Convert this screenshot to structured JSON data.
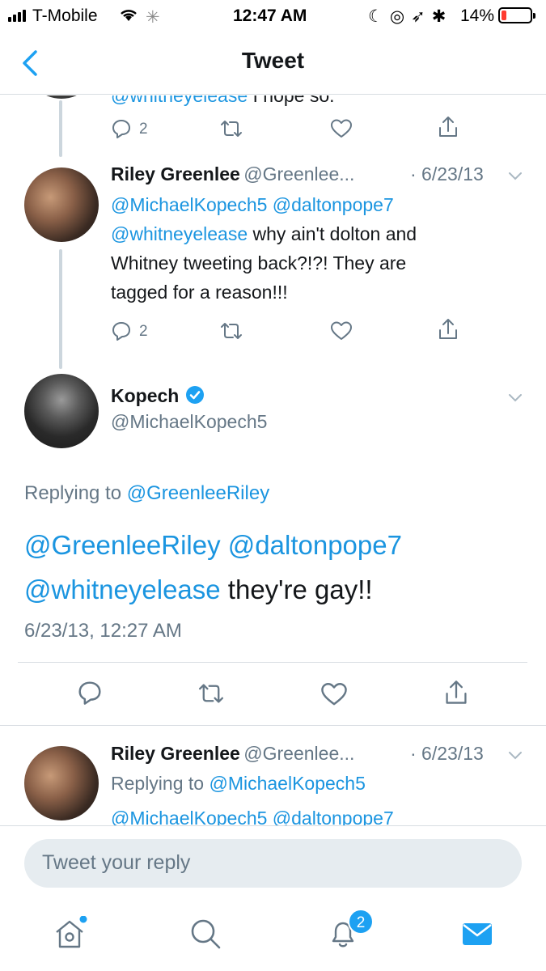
{
  "status_bar": {
    "carrier": "T-Mobile",
    "time": "12:47 AM",
    "battery": "14%"
  },
  "nav": {
    "title": "Tweet"
  },
  "top_tweet": {
    "partial_text_link": "@whitneyelease",
    "partial_text": " I hope so.",
    "reply_count": "2"
  },
  "reply_1": {
    "name": "Riley Greenlee",
    "handle": "@Greenlee...",
    "date": "· 6/23/13",
    "mentions": [
      "@MichaelKopech5",
      "@daltonpope7",
      "@whitneyelease"
    ],
    "text_line1": " why ain't dolton and",
    "text_line2": "Whitney tweeting back?!?! They are",
    "text_line3": "tagged for a reason!!!",
    "reply_count": "2"
  },
  "main_tweet": {
    "name": "Kopech",
    "handle": "@MichaelKopech5",
    "replying_prefix": "Replying to ",
    "replying_to": "@GreenleeRiley",
    "mentions": [
      "@GreenleeRiley",
      "@daltonpope7",
      "@whitneyelease"
    ],
    "text": " they're gay!!",
    "timestamp": "6/23/13, 12:27 AM"
  },
  "reply_2": {
    "name": "Riley Greenlee",
    "handle": "@Greenlee...",
    "date": "· 6/23/13",
    "replying_prefix": "Replying to ",
    "replying_to": "@MichaelKopech5",
    "mentions": [
      "@MichaelKopech5",
      "@daltonpope7"
    ]
  },
  "composer": {
    "placeholder": "Tweet your reply"
  },
  "tabbar": {
    "notifications_badge": "2"
  },
  "colors": {
    "accent": "#1da1f2",
    "link": "#1b95e0",
    "verified": "#1da1f2",
    "muted": "#657786"
  }
}
